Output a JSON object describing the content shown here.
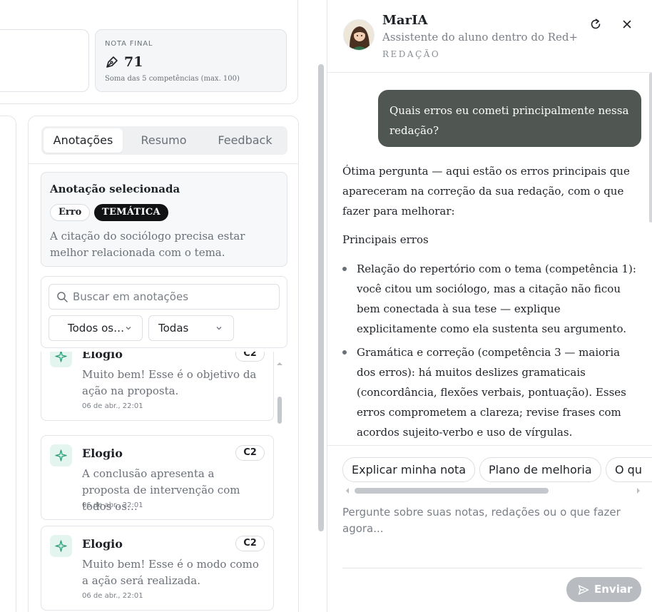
{
  "summary": {
    "final_label": "NOTA FINAL",
    "final_value": "71",
    "final_hint": "Soma das 5 competências (max. 100)"
  },
  "annotations": {
    "tabs": [
      {
        "label": "Anotações",
        "active": true
      },
      {
        "label": "Resumo",
        "active": false
      },
      {
        "label": "Feedback",
        "active": false
      }
    ],
    "selected": {
      "title": "Anotação selecionada",
      "chip_type": "Erro",
      "chip_category": "TEMÁTICA",
      "text": "A citação do sociólogo precisa estar melhor relacionada com o tema."
    },
    "search_placeholder": "Buscar em anotações",
    "filter_1": "Todos os…",
    "filter_2": "Todas",
    "items": [
      {
        "title": "Elogio",
        "badge": "C2",
        "text": "Muito bem! Esse é o objetivo da ação na proposta.",
        "date": "06 de abr., 22:01"
      },
      {
        "title": "Elogio",
        "badge": "C2",
        "text": "A conclusão apresenta a proposta de intervenção com todos os…",
        "date": "06 de abr., 22:01"
      },
      {
        "title": "Elogio",
        "badge": "C2",
        "text": "Muito bem! Esse é o modo como a ação será realizada.",
        "date": "06 de abr., 22:01"
      }
    ]
  },
  "chat": {
    "name": "MarIA",
    "subtitle": "Assistente do aluno dentro do Red+",
    "context": "REDAÇÃO",
    "icons": {
      "reset": "reset-icon",
      "close": "close-icon",
      "send": "send-icon"
    },
    "user_message": "Quais erros eu cometi principalmente nessa redação?",
    "reply_intro": "Ótima pergunta — aqui estão os erros principais que apareceram na correção da sua redação, com o que fazer para melhorar:",
    "reply_heading": "Principais erros",
    "reply_bullets": [
      "Relação do repertório com o tema (competência 1): você citou um sociólogo, mas a citação não ficou bem conectada à sua tese — explique explicitamente como ela sustenta seu argumento.",
      "Gramática e correção (competência 3 — maioria dos erros): há muitos deslizes gramaticais (concordância, flexões verbais, pontuação). Esses erros comprometem a clareza; revise frases com acordos sujeito-verbo e uso de vírgulas."
    ],
    "suggestions": [
      "Explicar minha nota",
      "Plano de melhoria",
      "O qu"
    ],
    "input_placeholder": "Pergunte sobre suas notas, redações ou o que fazer agora...",
    "send_label": "Enviar"
  }
}
